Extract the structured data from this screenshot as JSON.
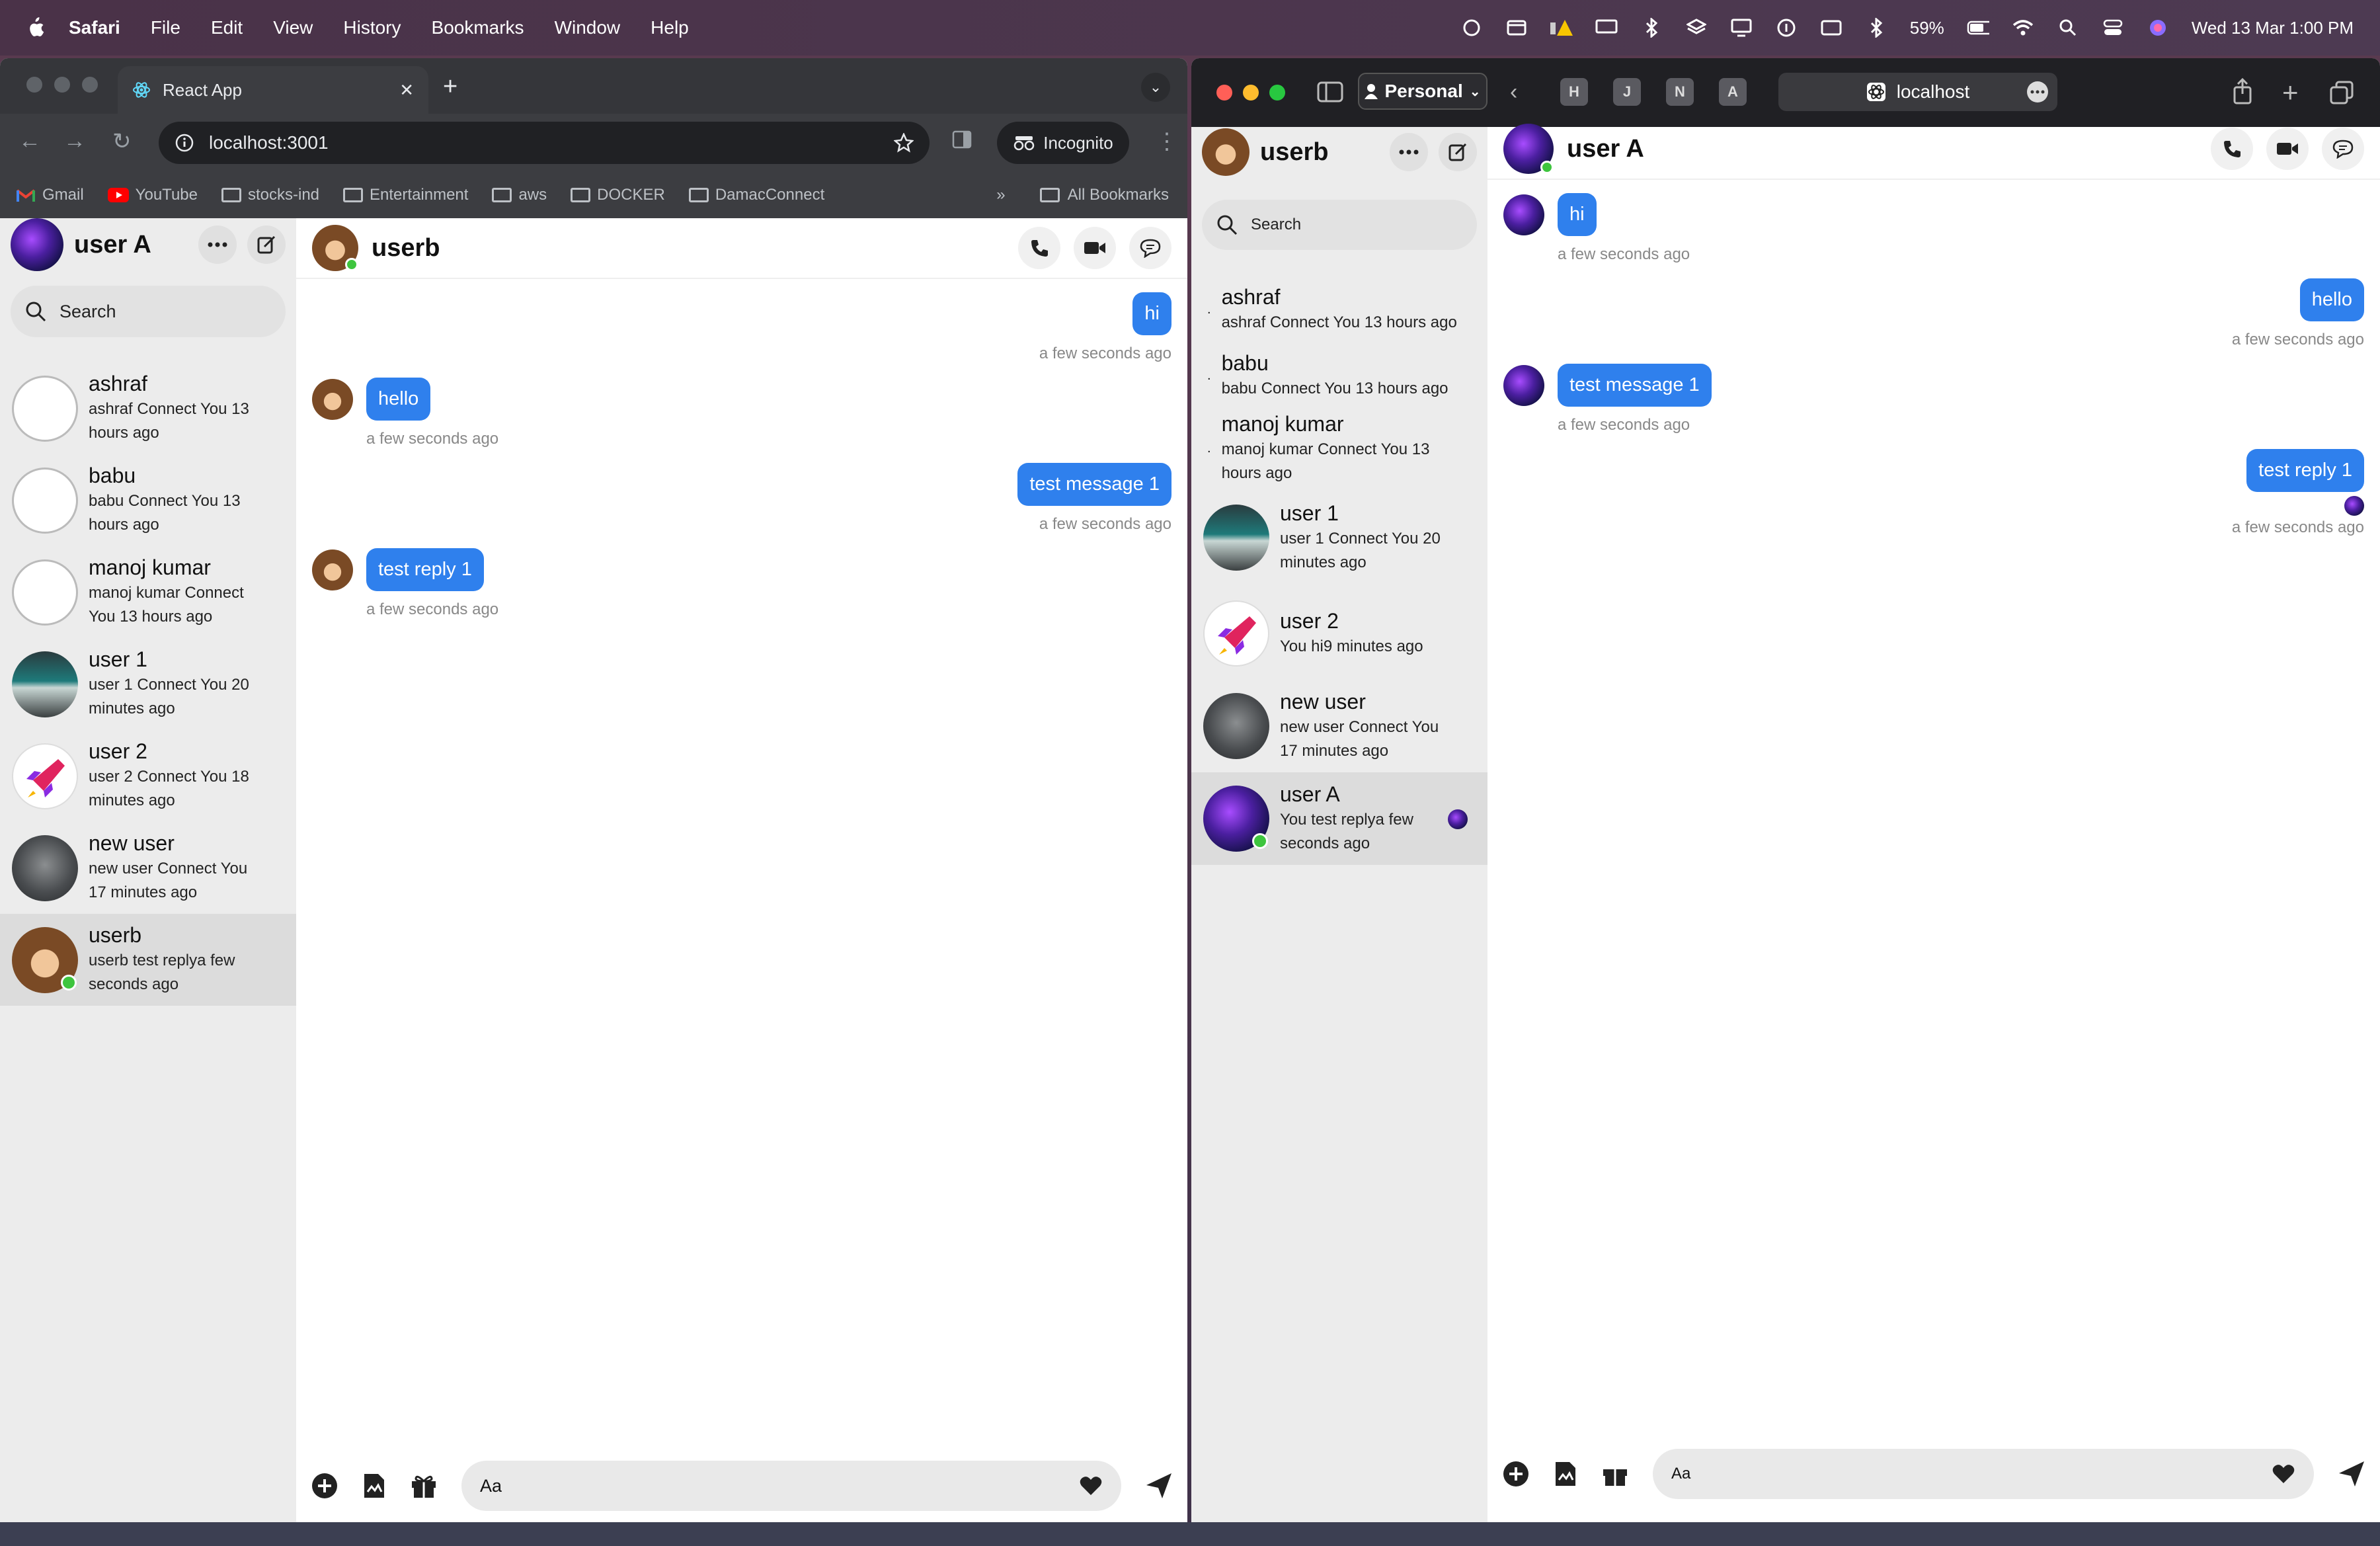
{
  "menubar": {
    "app": "Safari",
    "items": [
      "File",
      "Edit",
      "View",
      "History",
      "Bookmarks",
      "Window",
      "Help"
    ],
    "battery": "59%",
    "datetime": "Wed 13 Mar  1:00 PM"
  },
  "chrome": {
    "tab_title": "React App",
    "url": "localhost:3001",
    "incognito_label": "Incognito",
    "bookmarks": [
      "Gmail",
      "YouTube",
      "stocks-ind",
      "Entertainment",
      "aws",
      "DOCKER",
      "DamacConnect"
    ],
    "all_bookmarks": "All Bookmarks"
  },
  "safari": {
    "profile": "Personal",
    "tabs": [
      "H",
      "J",
      "N",
      "A"
    ],
    "url": "localhost"
  },
  "left_app": {
    "current_user": "user A",
    "search_placeholder": "Search",
    "conversations": [
      {
        "name": "ashraf",
        "preview": "ashraf Connect You 13 hours ago"
      },
      {
        "name": "babu",
        "preview": "babu Connect You 13 hours ago"
      },
      {
        "name": "manoj kumar",
        "preview": "manoj kumar Connect You 13 hours ago"
      },
      {
        "name": "user 1",
        "preview": "user 1 Connect You 20 minutes ago"
      },
      {
        "name": "user 2",
        "preview": "user 2 Connect You 18 minutes ago"
      },
      {
        "name": "new user",
        "preview": "new user Connect You 17 minutes ago"
      },
      {
        "name": "userb",
        "preview": "userb test replya few seconds ago"
      }
    ],
    "chat_title": "userb",
    "messages": [
      {
        "dir": "out",
        "text": "hi",
        "time": "a few seconds ago"
      },
      {
        "dir": "in",
        "text": "hello",
        "time": "a few seconds ago"
      },
      {
        "dir": "out",
        "text": "test message 1",
        "time": "a few seconds ago"
      },
      {
        "dir": "in",
        "text": "test reply 1",
        "time": "a few seconds ago"
      }
    ],
    "composer_placeholder": "Aa"
  },
  "right_app": {
    "current_user": "userb",
    "search_placeholder": "Search",
    "conversations": [
      {
        "name": "ashraf",
        "preview": "ashraf Connect You 13 hours ago"
      },
      {
        "name": "babu",
        "preview": "babu Connect You 13 hours ago"
      },
      {
        "name": "manoj kumar",
        "preview": "manoj kumar Connect You 13 hours ago"
      },
      {
        "name": "user 1",
        "preview": "user 1 Connect You 20 minutes ago"
      },
      {
        "name": "user 2",
        "preview": "You hi9 minutes ago"
      },
      {
        "name": "new user",
        "preview": "new user Connect You 17 minutes ago"
      },
      {
        "name": "user A",
        "preview": "You test replya few seconds ago"
      }
    ],
    "chat_title": "user A",
    "messages": [
      {
        "dir": "in",
        "text": "hi",
        "time": "a few seconds ago"
      },
      {
        "dir": "out",
        "text": "hello",
        "time": "a few seconds ago"
      },
      {
        "dir": "in",
        "text": "test message 1",
        "time": "a few seconds ago"
      },
      {
        "dir": "out",
        "text": "test reply 1",
        "time": "a few seconds ago"
      }
    ],
    "composer_placeholder": "Aa"
  }
}
